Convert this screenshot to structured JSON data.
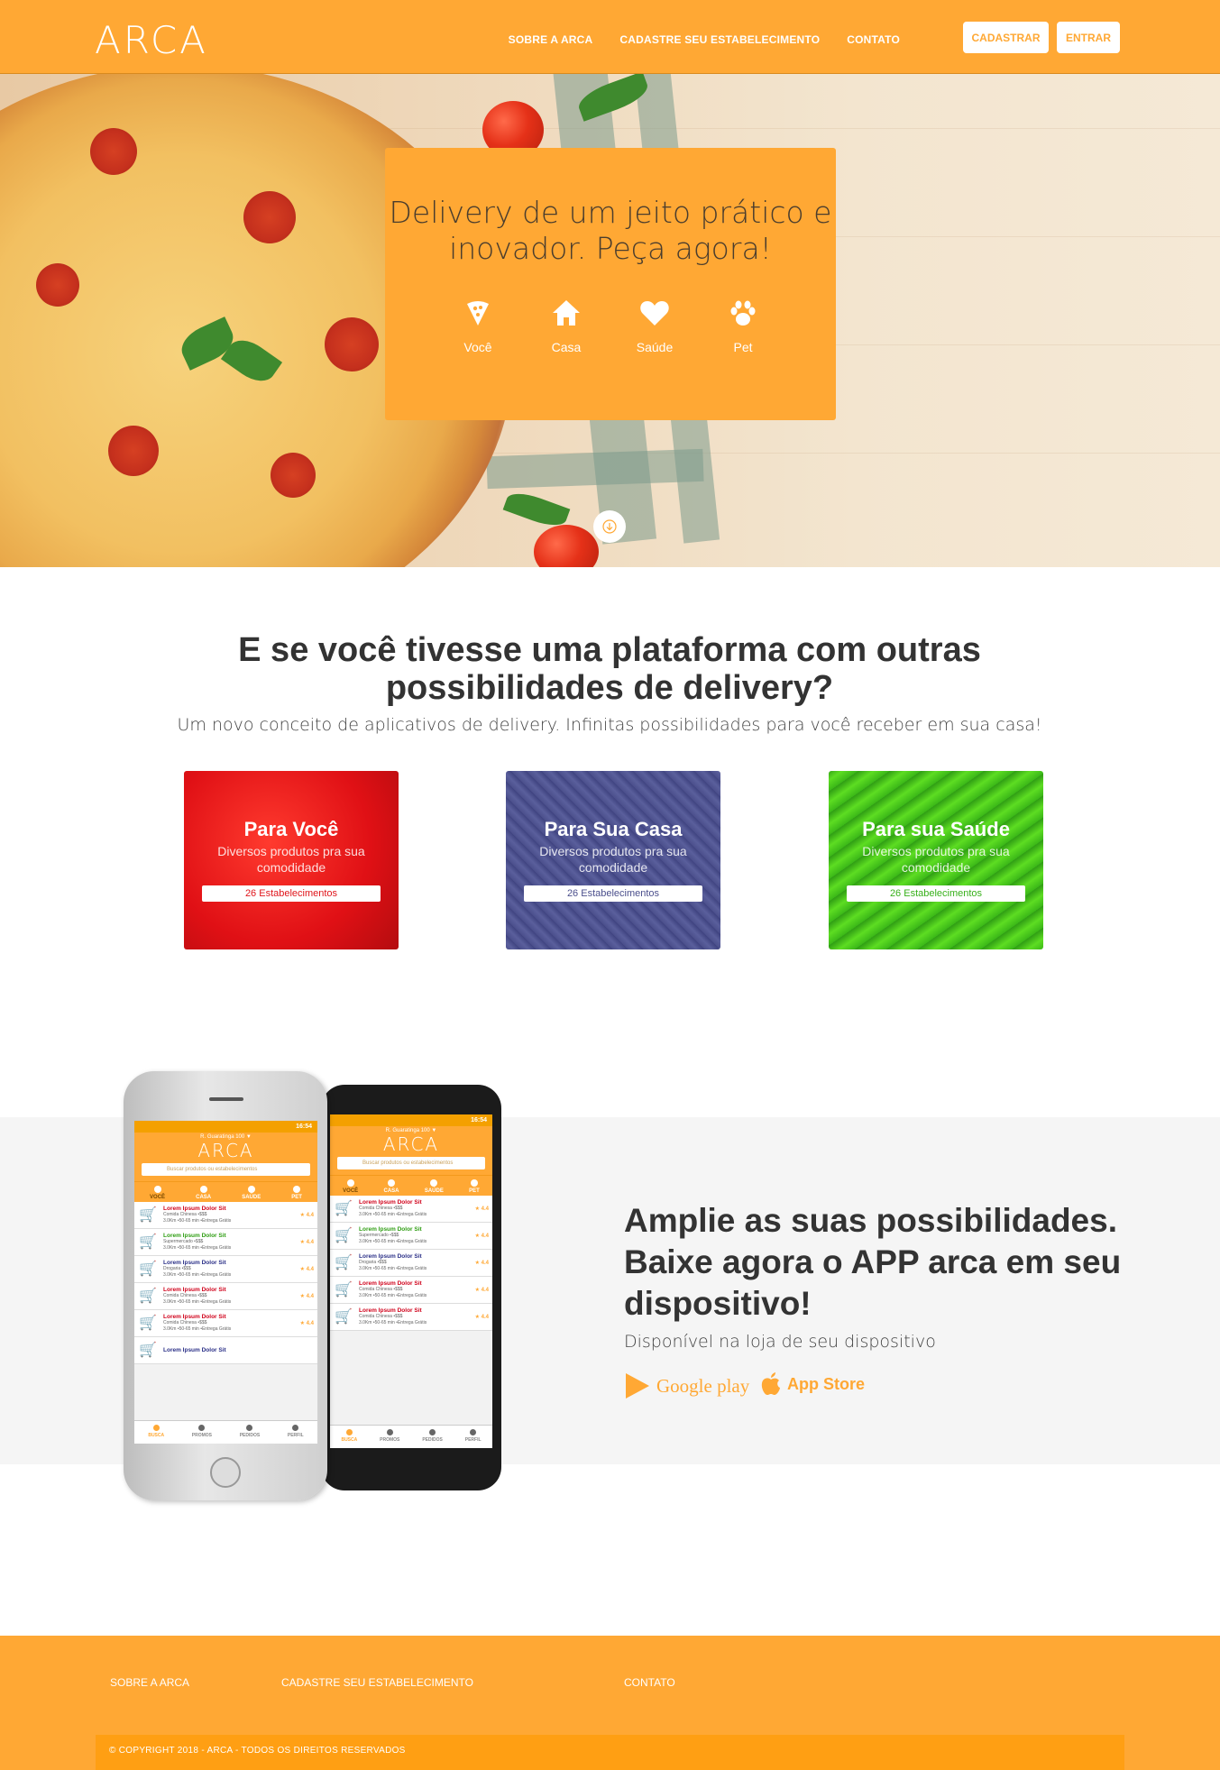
{
  "header": {
    "logo": "ARCA",
    "nav": [
      "SOBRE A ARCA",
      "CADASTRE SEU ESTABELECIMENTO",
      "CONTATO"
    ],
    "register_label": "CADASTRAR",
    "login_label": "ENTRAR"
  },
  "hero": {
    "title": "Delivery de um jeito prático e inovador. Peça agora!",
    "categories": [
      {
        "label": "Você",
        "icon": "pizza-slice-icon"
      },
      {
        "label": "Casa",
        "icon": "home-icon"
      },
      {
        "label": "Saúde",
        "icon": "heart-icon"
      },
      {
        "label": "Pet",
        "icon": "paw-icon"
      }
    ],
    "scroll_icon": "arrow-down-icon"
  },
  "possibilities": {
    "title": "E se você tivesse uma plataforma com outras possibilidades de delivery?",
    "subtitle": "Um novo conceito de aplicativos de delivery. Infinitas possibilidades para você receber em sua casa!",
    "cards": [
      {
        "title": "Para Você",
        "description": "Diversos produtos pra sua comodidade",
        "badge": "26 Estabelecimentos"
      },
      {
        "title": "Para Sua Casa",
        "description": "Diversos produtos pra sua comodidade",
        "badge": "26 Estabelecimentos"
      },
      {
        "title": "Para sua Saúde",
        "description": "Diversos produtos pra sua comodidade",
        "badge": "26 Estabelecimentos"
      }
    ]
  },
  "app": {
    "title": "Amplie as suas possibilidades. Baixe agora o APP arca em seu dispositivo!",
    "subtitle": "Disponível na loja de seu dispositivo",
    "google_play": "Google play",
    "app_store": "App Store",
    "mock": {
      "time": "16:54",
      "address": "R. Guaratinga 100 ▼",
      "logo": "ARCA",
      "search_placeholder": "Buscar produtos ou estabelecimentos",
      "tabs": [
        "VOCÊ",
        "CASA",
        "SAÚDE",
        "PET"
      ],
      "items": [
        {
          "name": "Lorem Ipsum Dolor Sit",
          "type": "Comida Chinesa •$$$",
          "info": "3.0Km •50-65 min •Entrega Grátis",
          "rating": "★ 4.4",
          "color": "#d0021b"
        },
        {
          "name": "Lorem Ipsum Dolor Sit",
          "type": "Supermercado •$$$",
          "info": "3.0Km •50-65 min •Entrega Grátis",
          "rating": "★ 4.4",
          "color": "#2e9d12"
        },
        {
          "name": "Lorem Ipsum Dolor Sit",
          "type": "Drogaria •$$$",
          "info": "3.0Km •50-65 min •Entrega Grátis",
          "rating": "★ 4.4",
          "color": "#2a2f87"
        },
        {
          "name": "Lorem Ipsum Dolor Sit",
          "type": "Comida Chinesa •$$$",
          "info": "3.0Km •50-65 min •Entrega Grátis",
          "rating": "★ 4.4",
          "color": "#d0021b"
        },
        {
          "name": "Lorem Ipsum Dolor Sit",
          "type": "Comida Chinesa •$$$",
          "info": "3.0Km •50-65 min •Entrega Grátis",
          "rating": "★ 4.4",
          "color": "#d0021b"
        }
      ],
      "last_item": "Lorem Ipsum Dolor Sit",
      "bottom_nav": [
        "BUSCA",
        "PROMOS",
        "PEDIDOS",
        "PERFIL"
      ]
    }
  },
  "footer": {
    "links": [
      "SOBRE A ARCA",
      "CADASTRE SEU ESTABELECIMENTO",
      "CONTATO"
    ],
    "copyright": "© COPYRIGHT 2018 - ARCA - TODOS OS DIREITOS RESERVADOS"
  },
  "colors": {
    "brand": "#ffa834",
    "text": "#333333",
    "band": "#f5f5f5"
  }
}
